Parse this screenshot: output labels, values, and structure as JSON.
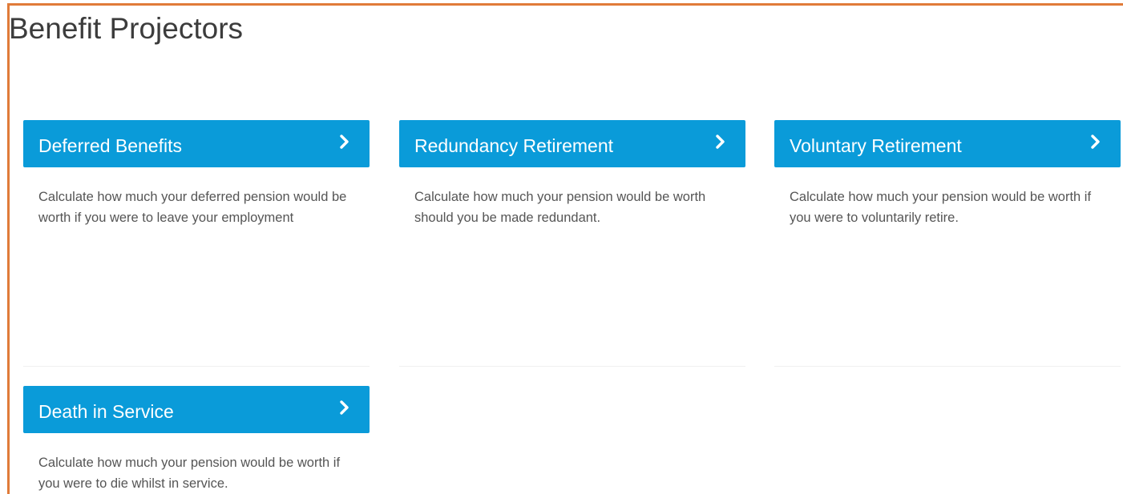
{
  "page": {
    "title": "Benefit Projectors"
  },
  "cards": [
    {
      "title": "Deferred Benefits",
      "description": "Calculate how much your deferred pension would be worth if you were to leave your employment",
      "icon": "chevron-right-icon"
    },
    {
      "title": "Redundancy Retirement",
      "description": "Calculate how much your pension would be worth should you be made redundant.",
      "icon": "chevron-right-icon"
    },
    {
      "title": "Voluntary Retirement",
      "description": "Calculate how much your pension would be worth if you were to voluntarily retire.",
      "icon": "chevron-right-icon"
    },
    {
      "title": "Death in Service",
      "description": "Calculate how much your pension would be worth if you were to die whilst in service.",
      "icon": "chevron-right-icon"
    }
  ],
  "colors": {
    "accent": "#0a9bd9",
    "frame": "#e07b39",
    "title_text": "#3c3c3c",
    "body_text": "#555555"
  }
}
